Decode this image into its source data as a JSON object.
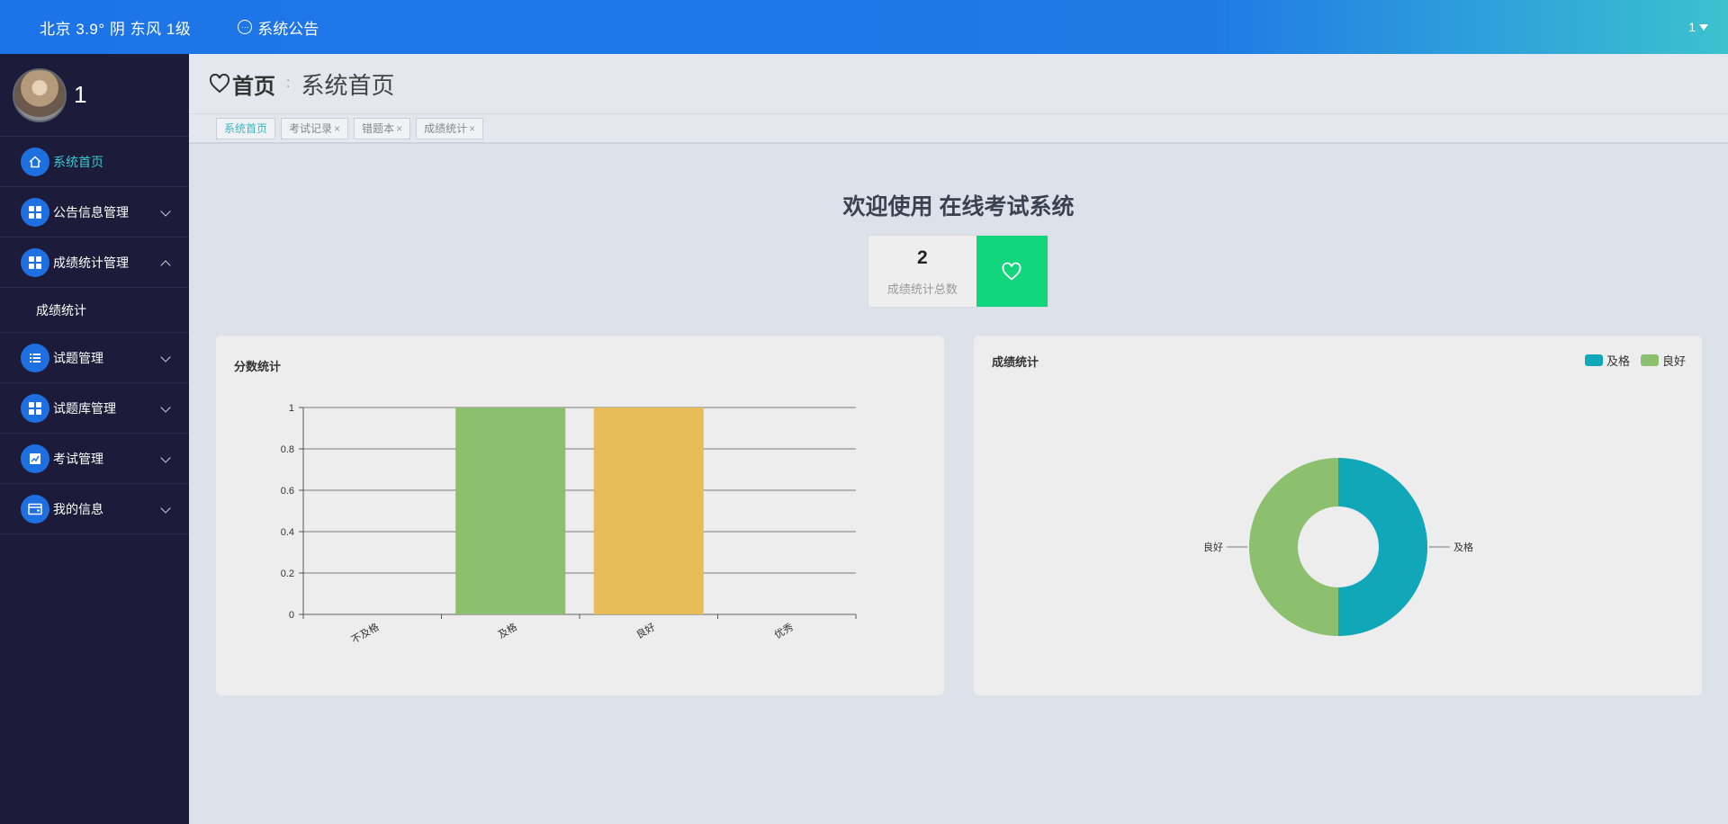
{
  "topbar": {
    "weather": "北京  3.9°  阴  东风  1级",
    "notice": "系统公告",
    "user": "1"
  },
  "sidebar": {
    "username": "1",
    "items": [
      {
        "label": "系统首页",
        "icon": "home-icon",
        "active": true
      },
      {
        "label": "公告信息管理",
        "icon": "grid-icon",
        "expanded": false
      },
      {
        "label": "成绩统计管理",
        "icon": "grid-icon",
        "expanded": true
      },
      {
        "label": "成绩统计",
        "submenu": true
      },
      {
        "label": "试题管理",
        "icon": "list-icon",
        "expanded": false
      },
      {
        "label": "试题库管理",
        "icon": "grid-icon",
        "expanded": false
      },
      {
        "label": "考试管理",
        "icon": "chart-icon",
        "expanded": false
      },
      {
        "label": "我的信息",
        "icon": "wallet-icon",
        "expanded": false
      }
    ]
  },
  "header": {
    "home": "首页",
    "separator": ":",
    "current": "系统首页"
  },
  "tabs": [
    {
      "label": "系统首页",
      "active": true,
      "closable": false
    },
    {
      "label": "考试记录",
      "closable": true
    },
    {
      "label": "错题本",
      "closable": true
    },
    {
      "label": "成绩统计",
      "closable": true
    }
  ],
  "welcome": "欢迎使用 在线考试系统",
  "stat": {
    "value": "2",
    "label": "成绩统计总数",
    "color": "#12d67c"
  },
  "chart_data": [
    {
      "type": "bar",
      "title": "分数统计",
      "categories": [
        "不及格",
        "及格",
        "良好",
        "优秀"
      ],
      "values": [
        0,
        1,
        1,
        0
      ],
      "colors": [
        "#8cc06f",
        "#8cc06f",
        "#e8bb59",
        "#8cc06f"
      ],
      "ylim": [
        0,
        1
      ],
      "yticks": [
        "0",
        "0.2",
        "0.4",
        "0.6",
        "0.8",
        "1"
      ],
      "grid": true
    },
    {
      "type": "pie",
      "title": "成绩统计",
      "labels": [
        "及格",
        "良好"
      ],
      "values": [
        1,
        1
      ],
      "colors": [
        "#10a7b9",
        "#8cc06f"
      ],
      "legend": "top-right"
    }
  ]
}
